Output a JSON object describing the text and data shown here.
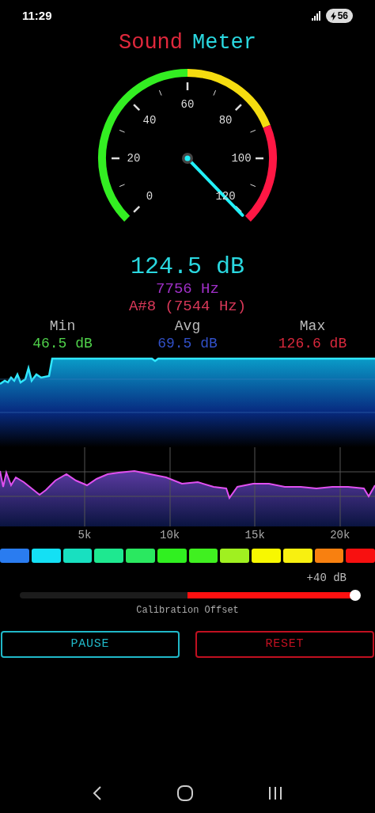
{
  "status_bar": {
    "time": "11:29",
    "battery": "56",
    "charging": true
  },
  "title": {
    "first": "Sound",
    "second": "Meter"
  },
  "gauge": {
    "ticks": [
      "0",
      "20",
      "40",
      "60",
      "80",
      "100",
      "120"
    ]
  },
  "reading": {
    "value": "124.5 dB",
    "frequency": "7756 Hz",
    "note": "A#8 (7544 Hz)"
  },
  "stats": [
    {
      "label": "Min",
      "value": "46.5 dB",
      "color": "#4fd14a"
    },
    {
      "label": "Avg",
      "value": "69.5 dB",
      "color": "#3150c8"
    },
    {
      "label": "Max",
      "value": "126.6 dB",
      "color": "#d8283c"
    }
  ],
  "spectrum": {
    "axis_labels": [
      "5k",
      "10k",
      "15k",
      "20k"
    ]
  },
  "level_bars": [
    {
      "color": "#2a7cf0"
    },
    {
      "color": "#14e0f4"
    },
    {
      "color": "#18e0c0"
    },
    {
      "color": "#1ee890"
    },
    {
      "color": "#2ae860"
    },
    {
      "color": "#30f020"
    },
    {
      "color": "#40f020"
    },
    {
      "color": "#a0f020"
    },
    {
      "color": "#f8f800"
    },
    {
      "color": "#f8f010"
    },
    {
      "color": "#f88010"
    },
    {
      "color": "#f81010"
    }
  ],
  "calibration": {
    "reading": "+40 dB",
    "label": "Calibration Offset",
    "level": 1.0
  },
  "buttons": [
    {
      "label": "PAUSE",
      "kind": "primary"
    },
    {
      "label": "RESET",
      "kind": "danger"
    }
  ]
}
